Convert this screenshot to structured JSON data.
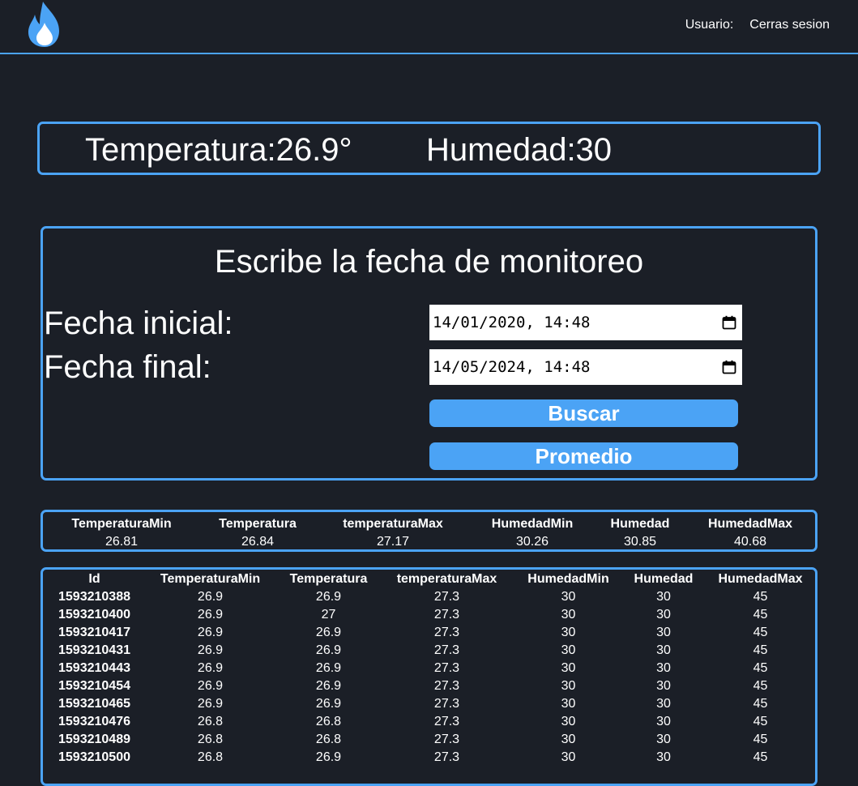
{
  "header": {
    "logo_icon": "flame-icon",
    "user_label": "Usuario:",
    "logout_label": "Cerras sesion",
    "accent_color": "#4ba3f5"
  },
  "current": {
    "temperature": "Temperatura:26.9°",
    "humidity": "Humedad:30"
  },
  "form": {
    "title": "Escribe la fecha de monitoreo",
    "start_label": "Fecha inicial:",
    "start_value": "14/01/2020, 14:48",
    "end_label": "Fecha final:",
    "end_value": "14/05/2024, 14:48",
    "search_button": "Buscar",
    "average_button": "Promedio"
  },
  "averages": {
    "headers": [
      "TemperaturaMin",
      "Temperatura",
      "temperaturaMax",
      "HumedadMin",
      "Humedad",
      "HumedadMax"
    ],
    "values": [
      "26.81",
      "26.84",
      "27.17",
      "30.26",
      "30.85",
      "40.68"
    ]
  },
  "records": {
    "headers": [
      "Id",
      "TemperaturaMin",
      "Temperatura",
      "temperaturaMax",
      "HumedadMin",
      "Humedad",
      "HumedadMax"
    ],
    "rows": [
      [
        "1593210388",
        "26.9",
        "26.9",
        "27.3",
        "30",
        "30",
        "45"
      ],
      [
        "1593210400",
        "26.9",
        "27",
        "27.3",
        "30",
        "30",
        "45"
      ],
      [
        "1593210417",
        "26.9",
        "26.9",
        "27.3",
        "30",
        "30",
        "45"
      ],
      [
        "1593210431",
        "26.9",
        "26.9",
        "27.3",
        "30",
        "30",
        "45"
      ],
      [
        "1593210443",
        "26.9",
        "26.9",
        "27.3",
        "30",
        "30",
        "45"
      ],
      [
        "1593210454",
        "26.9",
        "26.9",
        "27.3",
        "30",
        "30",
        "45"
      ],
      [
        "1593210465",
        "26.9",
        "26.9",
        "27.3",
        "30",
        "30",
        "45"
      ],
      [
        "1593210476",
        "26.8",
        "26.8",
        "27.3",
        "30",
        "30",
        "45"
      ],
      [
        "1593210489",
        "26.8",
        "26.8",
        "27.3",
        "30",
        "30",
        "45"
      ],
      [
        "1593210500",
        "26.8",
        "26.9",
        "27.3",
        "30",
        "30",
        "45"
      ]
    ]
  }
}
